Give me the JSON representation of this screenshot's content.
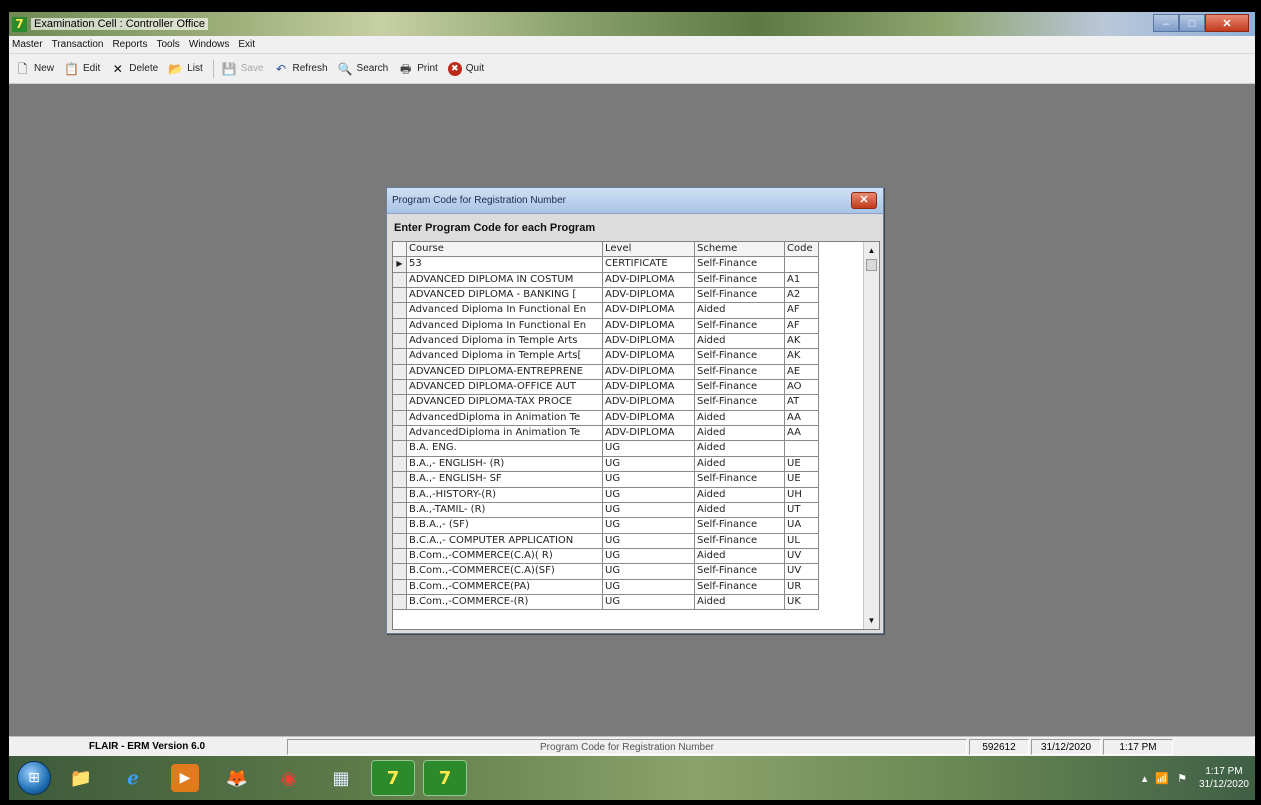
{
  "window": {
    "title": "Examination Cell : Controller Office",
    "icon_glyph": "7",
    "minimize_glyph": "–",
    "maximize_glyph": "□",
    "close_glyph": "✕"
  },
  "menu": [
    "Master",
    "Transaction",
    "Reports",
    "Tools",
    "Windows",
    "Exit"
  ],
  "toolbar": {
    "new": {
      "label": "New",
      "glyph": "🗋"
    },
    "edit": {
      "label": "Edit",
      "glyph": "📋"
    },
    "delete": {
      "label": "Delete",
      "glyph": "✕"
    },
    "list": {
      "label": "List",
      "glyph": "📂"
    },
    "save": {
      "label": "Save",
      "glyph": "💾"
    },
    "refresh": {
      "label": "Refresh",
      "glyph": "↶"
    },
    "search": {
      "label": "Search",
      "glyph": "🔍"
    },
    "print": {
      "label": "Print",
      "glyph": "🖶"
    },
    "quit": {
      "label": "Quit",
      "glyph": "✖"
    }
  },
  "dialog": {
    "title": "Program Code for Registration Number",
    "close_glyph": "✕",
    "heading": "Enter Program Code for each Program",
    "columns": [
      "Course",
      "Level",
      "Scheme",
      "Code"
    ],
    "row_indicator": "▶",
    "rows": [
      {
        "course": "53",
        "level": "CERTIFICATE",
        "scheme": "Self-Finance",
        "code": ""
      },
      {
        "course": "ADVANCED DIPLOMA IN COSTUM",
        "level": "ADV-DIPLOMA",
        "scheme": "Self-Finance",
        "code": "A1"
      },
      {
        "course": "ADVANCED DIPLOMA - BANKING [",
        "level": "ADV-DIPLOMA",
        "scheme": "Self-Finance",
        "code": "A2"
      },
      {
        "course": "Advanced Diploma In Functional En",
        "level": "ADV-DIPLOMA",
        "scheme": "Aided",
        "code": "AF"
      },
      {
        "course": "Advanced Diploma In Functional En",
        "level": "ADV-DIPLOMA",
        "scheme": "Self-Finance",
        "code": "AF"
      },
      {
        "course": "Advanced Diploma in Temple Arts",
        "level": "ADV-DIPLOMA",
        "scheme": "Aided",
        "code": "AK"
      },
      {
        "course": "Advanced Diploma in Temple Arts[",
        "level": "ADV-DIPLOMA",
        "scheme": "Self-Finance",
        "code": "AK"
      },
      {
        "course": "ADVANCED DIPLOMA-ENTREPRENE",
        "level": "ADV-DIPLOMA",
        "scheme": "Self-Finance",
        "code": "AE"
      },
      {
        "course": "ADVANCED DIPLOMA-OFFICE AUT",
        "level": "ADV-DIPLOMA",
        "scheme": "Self-Finance",
        "code": "AO"
      },
      {
        "course": "ADVANCED DIPLOMA-TAX PROCE",
        "level": "ADV-DIPLOMA",
        "scheme": "Self-Finance",
        "code": "AT"
      },
      {
        "course": "AdvancedDiploma in Animation Te",
        "level": "ADV-DIPLOMA",
        "scheme": "Aided",
        "code": "AA"
      },
      {
        "course": "AdvancedDiploma in Animation Te",
        "level": "ADV-DIPLOMA",
        "scheme": "Aided",
        "code": "AA"
      },
      {
        "course": "B.A. ENG.",
        "level": "UG",
        "scheme": "Aided",
        "code": ""
      },
      {
        "course": "B.A.,- ENGLISH- (R)",
        "level": "UG",
        "scheme": "Aided",
        "code": "UE"
      },
      {
        "course": "B.A.,- ENGLISH- SF",
        "level": "UG",
        "scheme": "Self-Finance",
        "code": "UE"
      },
      {
        "course": "B.A.,-HISTORY-(R)",
        "level": "UG",
        "scheme": "Aided",
        "code": "UH"
      },
      {
        "course": "B.A.,-TAMIL- (R)",
        "level": "UG",
        "scheme": "Aided",
        "code": "UT"
      },
      {
        "course": "B.B.A.,- (SF)",
        "level": "UG",
        "scheme": "Self-Finance",
        "code": "UA"
      },
      {
        "course": "B.C.A.,- COMPUTER APPLICATION",
        "level": "UG",
        "scheme": "Self-Finance",
        "code": "UL"
      },
      {
        "course": "B.Com.,-COMMERCE(C.A)( R)",
        "level": "UG",
        "scheme": "Aided",
        "code": "UV"
      },
      {
        "course": "B.Com.,-COMMERCE(C.A)(SF)",
        "level": "UG",
        "scheme": "Self-Finance",
        "code": "UV"
      },
      {
        "course": "B.Com.,-COMMERCE(PA)",
        "level": "UG",
        "scheme": "Self-Finance",
        "code": "UR"
      },
      {
        "course": "B.Com.,-COMMERCE-(R)",
        "level": "UG",
        "scheme": "Aided",
        "code": "UK"
      }
    ],
    "scroll_up_glyph": "▲",
    "scroll_down_glyph": "▼"
  },
  "status": {
    "version": "FLAIR - ERM Version 6.0",
    "form": "Program Code for Registration Number",
    "id": "592612",
    "date": "31/12/2020",
    "time": "1:17 PM"
  },
  "taskbar": {
    "start_glyph": "⊞",
    "apps": [
      {
        "name": "explorer",
        "glyph": "📁"
      },
      {
        "name": "ie",
        "glyph": "ℯ"
      },
      {
        "name": "media",
        "glyph": "▶"
      },
      {
        "name": "firefox",
        "glyph": "🦊"
      },
      {
        "name": "chrome",
        "glyph": "◉"
      },
      {
        "name": "notes",
        "glyph": "▦"
      },
      {
        "name": "flair1",
        "glyph": "7"
      },
      {
        "name": "flair2",
        "glyph": "7"
      }
    ],
    "tray": {
      "show_hidden_glyph": "▴",
      "network_glyph": "📶",
      "flag_glyph": "⚑",
      "clock_time": "1:17 PM",
      "clock_date": "31/12/2020"
    }
  },
  "colors": {
    "desktop": "#7a7a7a",
    "dialog_bg": "#dcdcdc",
    "grid_line": "#8a8a8a"
  }
}
